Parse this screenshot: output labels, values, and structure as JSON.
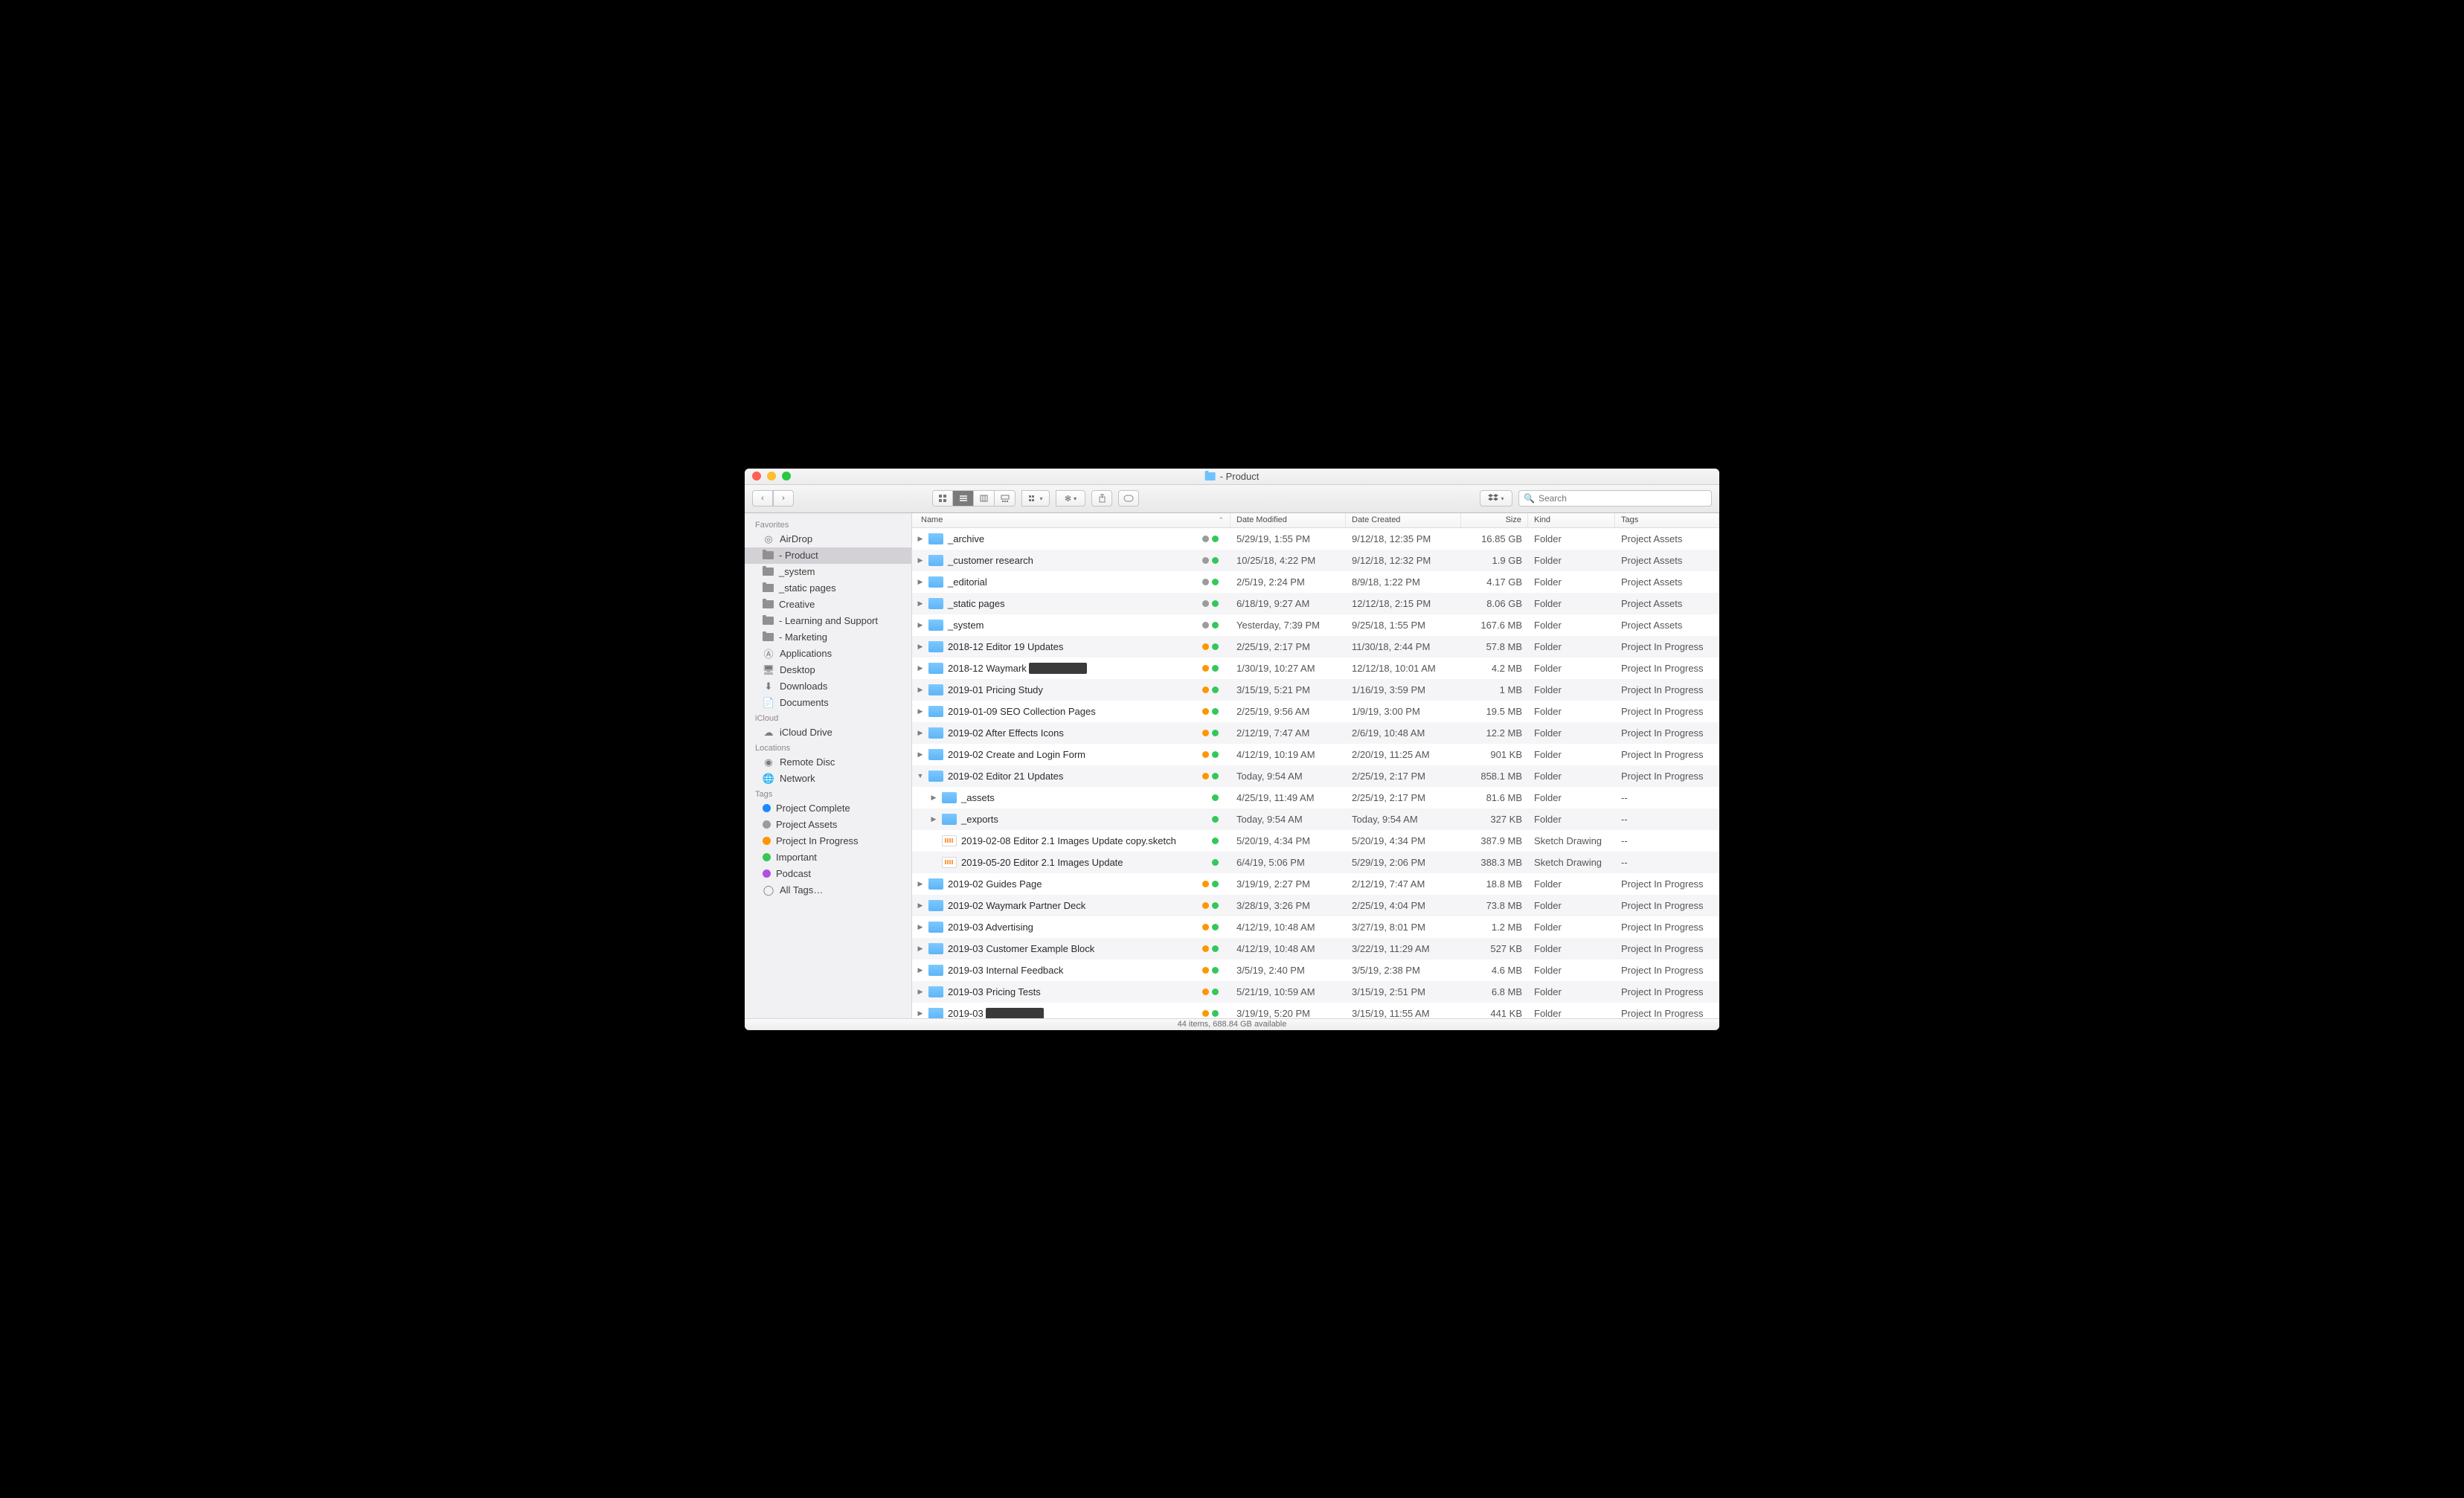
{
  "window_title": "- Product",
  "search_placeholder": "Search",
  "sidebar": {
    "sections": [
      {
        "title": "Favorites",
        "items": [
          {
            "label": "AirDrop",
            "icon": "airdrop"
          },
          {
            "label": "- Product",
            "icon": "folder",
            "selected": true
          },
          {
            "label": "_system",
            "icon": "folder"
          },
          {
            "label": "_static pages",
            "icon": "folder"
          },
          {
            "label": "Creative",
            "icon": "folder"
          },
          {
            "label": "- Learning and Support",
            "icon": "folder"
          },
          {
            "label": "- Marketing",
            "icon": "folder"
          },
          {
            "label": "Applications",
            "icon": "apps"
          },
          {
            "label": "Desktop",
            "icon": "desktop"
          },
          {
            "label": "Downloads",
            "icon": "downloads"
          },
          {
            "label": "Documents",
            "icon": "documents"
          }
        ]
      },
      {
        "title": "iCloud",
        "items": [
          {
            "label": "iCloud Drive",
            "icon": "icloud"
          }
        ]
      },
      {
        "title": "Locations",
        "items": [
          {
            "label": "Remote Disc",
            "icon": "disc"
          },
          {
            "label": "Network",
            "icon": "network"
          }
        ]
      },
      {
        "title": "Tags",
        "items": [
          {
            "label": "Project Complete",
            "icon": "tag",
            "color": "#1e88ff"
          },
          {
            "label": "Project Assets",
            "icon": "tag",
            "color": "#9b9b9b"
          },
          {
            "label": "Project In Progress",
            "icon": "tag",
            "color": "#ff9500"
          },
          {
            "label": "Important",
            "icon": "tag",
            "color": "#34c759"
          },
          {
            "label": "Podcast",
            "icon": "tag",
            "color": "#af52de"
          },
          {
            "label": "All Tags…",
            "icon": "alltags"
          }
        ]
      }
    ]
  },
  "columns": {
    "name": "Name",
    "dm": "Date Modified",
    "dc": "Date Created",
    "sz": "Size",
    "kd": "Kind",
    "tg": "Tags"
  },
  "tag_colors": {
    "assets": "#9b9b9b",
    "progress": "#ff9500",
    "sync": "#34c759"
  },
  "rows": [
    {
      "indent": 0,
      "expand": "closed",
      "icon": "folder",
      "name": "_archive",
      "dots": [
        "assets",
        "sync"
      ],
      "dm": "5/29/19, 1:55 PM",
      "dc": "9/12/18, 12:35 PM",
      "sz": "16.85 GB",
      "kd": "Folder",
      "tg": "Project Assets"
    },
    {
      "indent": 0,
      "expand": "closed",
      "icon": "folder",
      "name": "_customer research",
      "dots": [
        "assets",
        "sync"
      ],
      "dm": "10/25/18, 4:22 PM",
      "dc": "9/12/18, 12:32 PM",
      "sz": "1.9 GB",
      "kd": "Folder",
      "tg": "Project Assets"
    },
    {
      "indent": 0,
      "expand": "closed",
      "icon": "folder",
      "name": "_editorial",
      "dots": [
        "assets",
        "sync"
      ],
      "dm": "2/5/19, 2:24 PM",
      "dc": "8/9/18, 1:22 PM",
      "sz": "4.17 GB",
      "kd": "Folder",
      "tg": "Project Assets"
    },
    {
      "indent": 0,
      "expand": "closed",
      "icon": "folder",
      "name": "_static pages",
      "dots": [
        "assets",
        "sync"
      ],
      "dm": "6/18/19, 9:27 AM",
      "dc": "12/12/18, 2:15 PM",
      "sz": "8.06 GB",
      "kd": "Folder",
      "tg": "Project Assets"
    },
    {
      "indent": 0,
      "expand": "closed",
      "icon": "folder",
      "name": "_system",
      "dots": [
        "assets",
        "sync"
      ],
      "dm": "Yesterday, 7:39 PM",
      "dc": "9/25/18, 1:55 PM",
      "sz": "167.6 MB",
      "kd": "Folder",
      "tg": "Project Assets"
    },
    {
      "indent": 0,
      "expand": "closed",
      "icon": "folder",
      "name": "2018-12 Editor 19 Updates",
      "dots": [
        "progress",
        "sync"
      ],
      "dm": "2/25/19, 2:17 PM",
      "dc": "11/30/18, 2:44 PM",
      "sz": "57.8 MB",
      "kd": "Folder",
      "tg": "Project In Progress"
    },
    {
      "indent": 0,
      "expand": "closed",
      "icon": "folder",
      "name": "2018-12 Waymark",
      "redacted": true,
      "dots": [
        "progress",
        "sync"
      ],
      "dm": "1/30/19, 10:27 AM",
      "dc": "12/12/18, 10:01 AM",
      "sz": "4.2 MB",
      "kd": "Folder",
      "tg": "Project In Progress"
    },
    {
      "indent": 0,
      "expand": "closed",
      "icon": "folder",
      "name": "2019-01 Pricing Study",
      "dots": [
        "progress",
        "sync"
      ],
      "dm": "3/15/19, 5:21 PM",
      "dc": "1/16/19, 3:59 PM",
      "sz": "1 MB",
      "kd": "Folder",
      "tg": "Project In Progress"
    },
    {
      "indent": 0,
      "expand": "closed",
      "icon": "folder",
      "name": "2019-01-09 SEO Collection Pages",
      "dots": [
        "progress",
        "sync"
      ],
      "dm": "2/25/19, 9:56 AM",
      "dc": "1/9/19, 3:00 PM",
      "sz": "19.5 MB",
      "kd": "Folder",
      "tg": "Project In Progress"
    },
    {
      "indent": 0,
      "expand": "closed",
      "icon": "folder",
      "name": "2019-02 After Effects Icons",
      "dots": [
        "progress",
        "sync"
      ],
      "dm": "2/12/19, 7:47 AM",
      "dc": "2/6/19, 10:48 AM",
      "sz": "12.2 MB",
      "kd": "Folder",
      "tg": "Project In Progress"
    },
    {
      "indent": 0,
      "expand": "closed",
      "icon": "folder",
      "name": "2019-02 Create and Login Form",
      "dots": [
        "progress",
        "sync"
      ],
      "dm": "4/12/19, 10:19 AM",
      "dc": "2/20/19, 11:25 AM",
      "sz": "901 KB",
      "kd": "Folder",
      "tg": "Project In Progress"
    },
    {
      "indent": 0,
      "expand": "open",
      "icon": "folder",
      "name": "2019-02 Editor 21 Updates",
      "dots": [
        "progress",
        "sync"
      ],
      "dm": "Today, 9:54 AM",
      "dc": "2/25/19, 2:17 PM",
      "sz": "858.1 MB",
      "kd": "Folder",
      "tg": "Project In Progress"
    },
    {
      "indent": 1,
      "expand": "closed",
      "icon": "folder",
      "name": "_assets",
      "dots": [
        "sync"
      ],
      "dm": "4/25/19, 11:49 AM",
      "dc": "2/25/19, 2:17 PM",
      "sz": "81.6 MB",
      "kd": "Folder",
      "tg": "--"
    },
    {
      "indent": 1,
      "expand": "closed",
      "icon": "folder",
      "name": "_exports",
      "dots": [
        "sync"
      ],
      "dm": "Today, 9:54 AM",
      "dc": "Today, 9:54 AM",
      "sz": "327 KB",
      "kd": "Folder",
      "tg": "--"
    },
    {
      "indent": 1,
      "expand": "none",
      "icon": "sketch",
      "name": "2019-02-08 Editor 2.1 Images Update copy.sketch",
      "dots": [
        "sync"
      ],
      "dm": "5/20/19, 4:34 PM",
      "dc": "5/20/19, 4:34 PM",
      "sz": "387.9 MB",
      "kd": "Sketch Drawing",
      "tg": "--"
    },
    {
      "indent": 1,
      "expand": "none",
      "icon": "sketch",
      "name": "2019-05-20 Editor 2.1 Images Update",
      "dots": [
        "sync"
      ],
      "dm": "6/4/19, 5:06 PM",
      "dc": "5/29/19, 2:06 PM",
      "sz": "388.3 MB",
      "kd": "Sketch Drawing",
      "tg": "--"
    },
    {
      "indent": 0,
      "expand": "closed",
      "icon": "folder",
      "name": "2019-02 Guides Page",
      "dots": [
        "progress",
        "sync"
      ],
      "dm": "3/19/19, 2:27 PM",
      "dc": "2/12/19, 7:47 AM",
      "sz": "18.8 MB",
      "kd": "Folder",
      "tg": "Project In Progress"
    },
    {
      "indent": 0,
      "expand": "closed",
      "icon": "folder",
      "name": "2019-02 Waymark Partner Deck",
      "dots": [
        "progress",
        "sync"
      ],
      "dm": "3/28/19, 3:26 PM",
      "dc": "2/25/19, 4:04 PM",
      "sz": "73.8 MB",
      "kd": "Folder",
      "tg": "Project In Progress"
    },
    {
      "indent": 0,
      "expand": "closed",
      "icon": "folder",
      "name": "2019-03 Advertising",
      "dots": [
        "progress",
        "sync"
      ],
      "dm": "4/12/19, 10:48 AM",
      "dc": "3/27/19, 8:01 PM",
      "sz": "1.2 MB",
      "kd": "Folder",
      "tg": "Project In Progress"
    },
    {
      "indent": 0,
      "expand": "closed",
      "icon": "folder",
      "name": "2019-03 Customer Example Block",
      "dots": [
        "progress",
        "sync"
      ],
      "dm": "4/12/19, 10:48 AM",
      "dc": "3/22/19, 11:29 AM",
      "sz": "527 KB",
      "kd": "Folder",
      "tg": "Project In Progress"
    },
    {
      "indent": 0,
      "expand": "closed",
      "icon": "folder",
      "name": "2019-03 Internal Feedback",
      "dots": [
        "progress",
        "sync"
      ],
      "dm": "3/5/19, 2:40 PM",
      "dc": "3/5/19, 2:38 PM",
      "sz": "4.6 MB",
      "kd": "Folder",
      "tg": "Project In Progress"
    },
    {
      "indent": 0,
      "expand": "closed",
      "icon": "folder",
      "name": "2019-03 Pricing Tests",
      "dots": [
        "progress",
        "sync"
      ],
      "dm": "5/21/19, 10:59 AM",
      "dc": "3/15/19, 2:51 PM",
      "sz": "6.8 MB",
      "kd": "Folder",
      "tg": "Project In Progress"
    },
    {
      "indent": 0,
      "expand": "closed",
      "icon": "folder",
      "name": "2019-03",
      "redacted": true,
      "dots": [
        "progress",
        "sync"
      ],
      "dm": "3/19/19, 5:20 PM",
      "dc": "3/15/19, 11:55 AM",
      "sz": "441 KB",
      "kd": "Folder",
      "tg": "Project In Progress"
    }
  ],
  "statusbar": "44 items, 688.84 GB available"
}
